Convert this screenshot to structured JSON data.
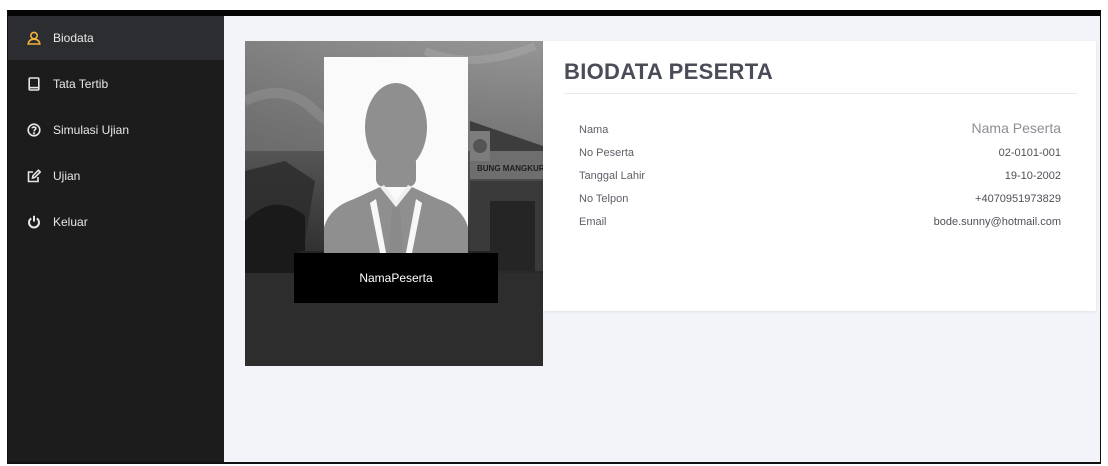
{
  "sidebar": {
    "items": [
      {
        "label": "Biodata",
        "icon": "user-icon",
        "active": true
      },
      {
        "label": "Tata Tertib",
        "icon": "tablet-icon",
        "active": false
      },
      {
        "label": "Simulasi Ujian",
        "icon": "question-circle-icon",
        "active": false
      },
      {
        "label": "Ujian",
        "icon": "edit-icon",
        "active": false
      },
      {
        "label": "Keluar",
        "icon": "power-icon",
        "active": false
      }
    ]
  },
  "profile": {
    "display_name": "NamaPeserta",
    "sign_text": "BUNG MANGKUR"
  },
  "biodata": {
    "title": "BIODATA PESERTA",
    "fields": [
      {
        "label": "Nama",
        "value": "Nama Peserta"
      },
      {
        "label": "No Peserta",
        "value": "02-0101-001"
      },
      {
        "label": "Tanggal Lahir",
        "value": "19-10-2002"
      },
      {
        "label": "No Telpon",
        "value": "+4070951973829"
      },
      {
        "label": "Email",
        "value": "bode.sunny@hotmail.com"
      }
    ]
  },
  "colors": {
    "accent": "#f3b13b",
    "sidebar_bg": "#1c1c1d",
    "sidebar_active": "#2b2d31"
  }
}
